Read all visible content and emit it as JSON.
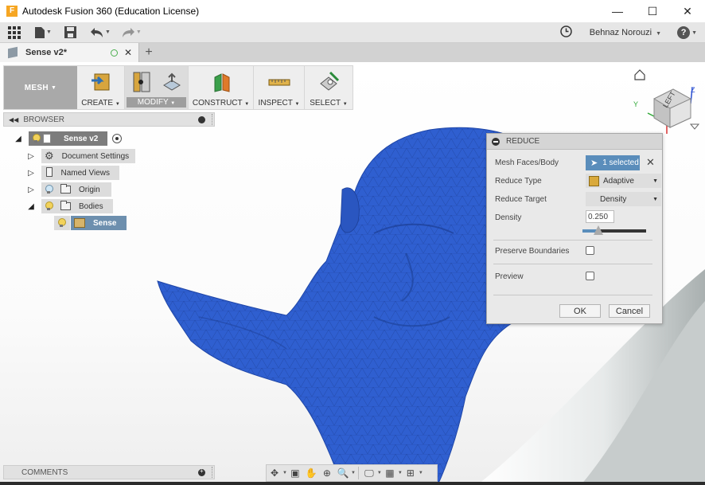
{
  "window": {
    "logo": "F",
    "title": "Autodesk Fusion 360 (Education License)",
    "minimize": "—",
    "maximize": "☐",
    "close": "✕"
  },
  "qat": {
    "user_name": "Behnaz Norouzi",
    "help_label": "?"
  },
  "document_tab": {
    "title": "Sense v2*",
    "close": "✕",
    "new_tab": "+"
  },
  "ribbon": {
    "workspace": "MESH",
    "groups": [
      {
        "label": "CREATE"
      },
      {
        "label": "MODIFY"
      },
      {
        "label": "CONSTRUCT"
      },
      {
        "label": "INSPECT"
      },
      {
        "label": "SELECT"
      }
    ]
  },
  "browser": {
    "title": "BROWSER",
    "root": "Sense v2",
    "items": [
      {
        "label": "Document Settings"
      },
      {
        "label": "Named Views"
      },
      {
        "label": "Origin"
      },
      {
        "label": "Bodies"
      },
      {
        "label": "Sense"
      }
    ]
  },
  "comments": {
    "title": "COMMENTS"
  },
  "reduce_dialog": {
    "title": "REDUCE",
    "mesh_faces_label": "Mesh Faces/Body",
    "selection_value": "1 selected",
    "reduce_type_label": "Reduce Type",
    "reduce_type_value": "Adaptive",
    "reduce_target_label": "Reduce Target",
    "reduce_target_value": "Density",
    "density_label": "Density",
    "density_value": "0.250",
    "density_fraction": 0.25,
    "preserve_boundaries_label": "Preserve Boundaries",
    "preview_label": "Preview",
    "ok_label": "OK",
    "cancel_label": "Cancel"
  },
  "viewcube": {
    "face_label": "LEFT",
    "axis_x": "Y",
    "axis_z": "Z"
  },
  "colors": {
    "mesh_body": "#2f5fd0",
    "accent": "#5a8dbb"
  }
}
